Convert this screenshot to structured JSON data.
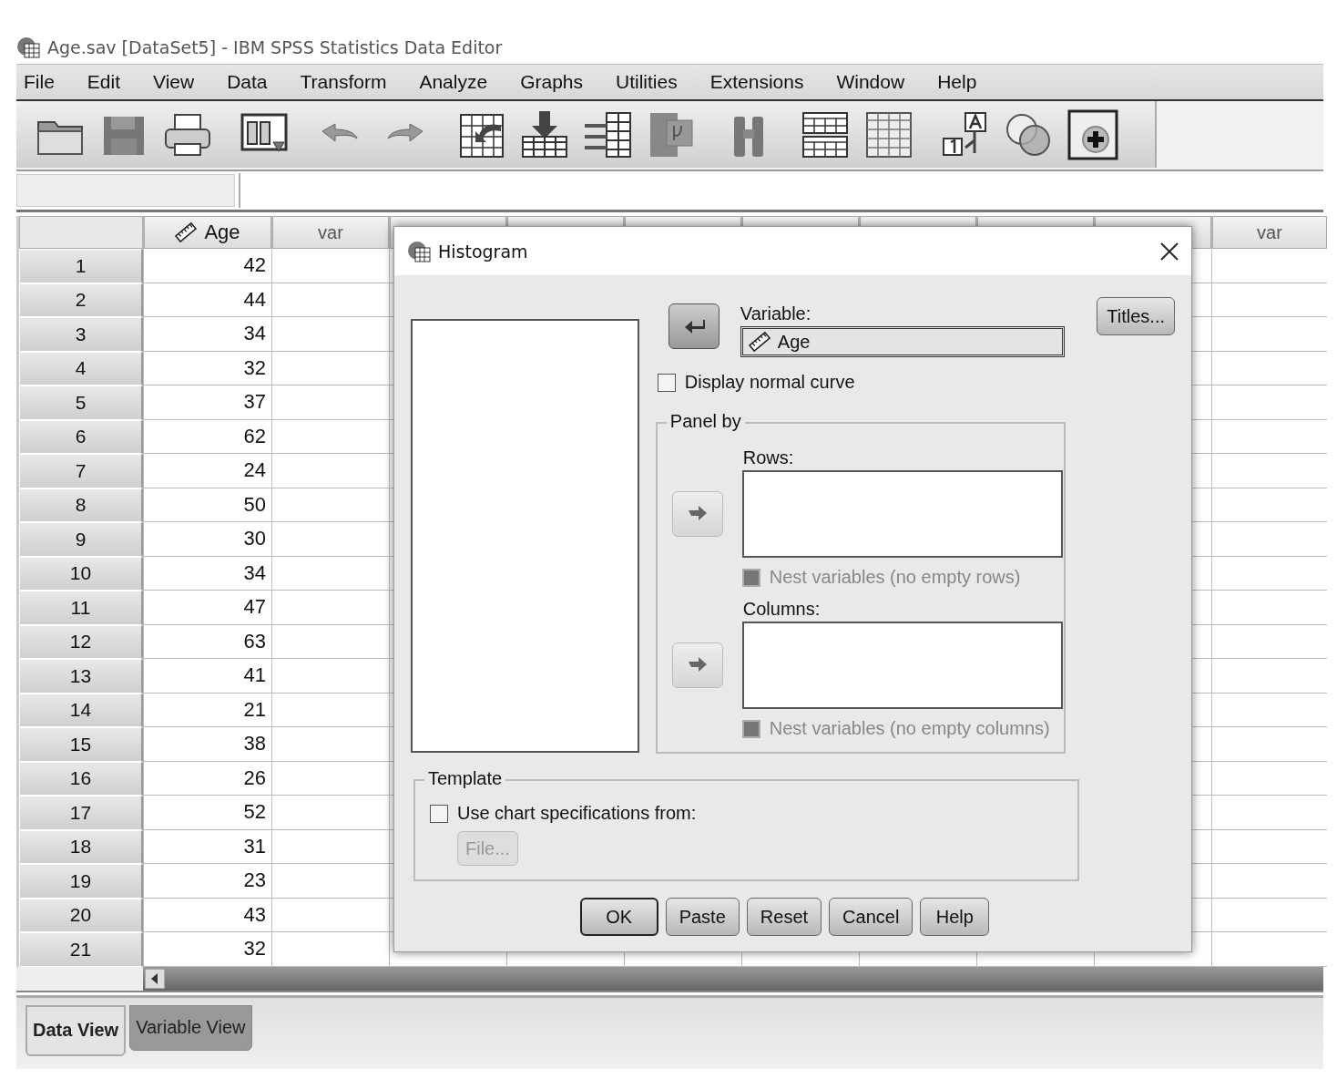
{
  "window": {
    "title": "Age.sav [DataSet5] - IBM SPSS Statistics Data Editor"
  },
  "menu": [
    "File",
    "Edit",
    "View",
    "Data",
    "Transform",
    "Analyze",
    "Graphs",
    "Utilities",
    "Extensions",
    "Window",
    "Help"
  ],
  "grid": {
    "columns": [
      {
        "label": "Age",
        "kind": "scale"
      },
      {
        "label": "var",
        "kind": "empty"
      }
    ],
    "right_columns": [
      {
        "label": "var"
      }
    ],
    "rows": [
      {
        "number": "1",
        "values": [
          "42"
        ]
      },
      {
        "number": "2",
        "values": [
          "44"
        ]
      },
      {
        "number": "3",
        "values": [
          "34"
        ]
      },
      {
        "number": "4",
        "values": [
          "32"
        ]
      },
      {
        "number": "5",
        "values": [
          "37"
        ]
      },
      {
        "number": "6",
        "values": [
          "62"
        ]
      },
      {
        "number": "7",
        "values": [
          "24"
        ]
      },
      {
        "number": "8",
        "values": [
          "50"
        ]
      },
      {
        "number": "9",
        "values": [
          "30"
        ]
      },
      {
        "number": "10",
        "values": [
          "34"
        ]
      },
      {
        "number": "11",
        "values": [
          "47"
        ]
      },
      {
        "number": "12",
        "values": [
          "63"
        ]
      },
      {
        "number": "13",
        "values": [
          "41"
        ]
      },
      {
        "number": "14",
        "values": [
          "21"
        ]
      },
      {
        "number": "15",
        "values": [
          "38"
        ]
      },
      {
        "number": "16",
        "values": [
          "26"
        ]
      },
      {
        "number": "17",
        "values": [
          "52"
        ]
      },
      {
        "number": "18",
        "values": [
          "31"
        ]
      },
      {
        "number": "19",
        "values": [
          "23"
        ]
      },
      {
        "number": "20",
        "values": [
          "43"
        ]
      },
      {
        "number": "21",
        "values": [
          "32"
        ]
      }
    ]
  },
  "dialog": {
    "title": "Histogram",
    "variable": {
      "label": "Variable:",
      "value": "Age",
      "kind": "scale",
      "move_disabled": false
    },
    "titles_button": "Titles...",
    "normal_curve": {
      "label": "Display normal curve",
      "checked": false
    },
    "panel_by": {
      "title": "Panel by",
      "rows": {
        "label": "Rows:",
        "move_disabled": true,
        "nest": {
          "label": "Nest variables (no empty rows)",
          "checked": false,
          "disabled": true
        }
      },
      "columns": {
        "label": "Columns:",
        "move_disabled": true,
        "nest": {
          "label": "Nest variables (no empty columns)",
          "checked": false,
          "disabled": true
        }
      }
    },
    "template": {
      "title": "Template",
      "use_spec": {
        "label": "Use chart specifications from:",
        "checked": false
      },
      "file_button": {
        "label": "File...",
        "disabled": true
      }
    },
    "buttons": [
      {
        "label": "OK",
        "default": true
      },
      {
        "label": "Paste",
        "default": false
      },
      {
        "label": "Reset",
        "default": false
      },
      {
        "label": "Cancel",
        "default": false
      },
      {
        "label": "Help",
        "default": false
      }
    ]
  },
  "view_tabs": [
    {
      "label": "Data View",
      "selected": true
    },
    {
      "label": "Variable View",
      "selected": false
    }
  ]
}
